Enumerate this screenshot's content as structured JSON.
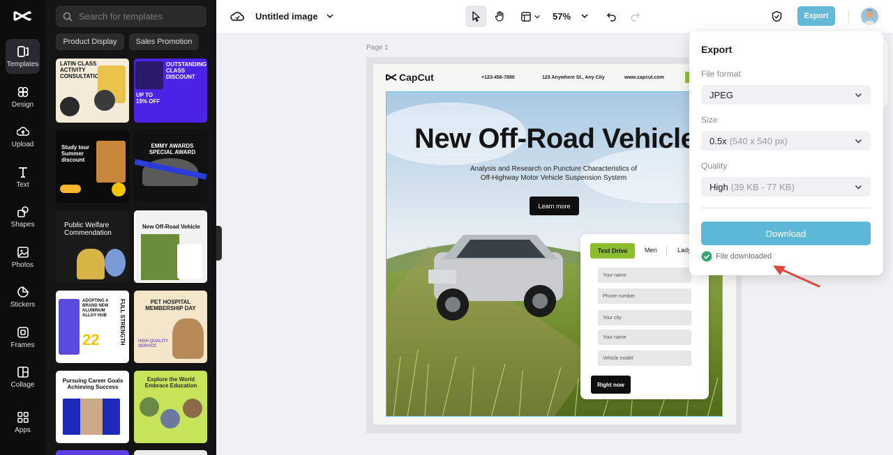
{
  "rail": {
    "items": [
      {
        "label": "Templates",
        "icon": "templates-icon"
      },
      {
        "label": "Design",
        "icon": "design-icon"
      },
      {
        "label": "Upload",
        "icon": "upload-icon"
      },
      {
        "label": "Text",
        "icon": "text-icon"
      },
      {
        "label": "Shapes",
        "icon": "shapes-icon"
      },
      {
        "label": "Photos",
        "icon": "photos-icon"
      },
      {
        "label": "Stickers",
        "icon": "stickers-icon"
      },
      {
        "label": "Frames",
        "icon": "frames-icon"
      },
      {
        "label": "Collage",
        "icon": "collage-icon"
      },
      {
        "label": "Apps",
        "icon": "apps-icon"
      }
    ],
    "active": "Templates"
  },
  "panel": {
    "search_placeholder": "Search for templates",
    "chips": [
      "Product Display",
      "Sales Promotion"
    ],
    "thumbs": [
      {
        "title": "LATIN CLASS ACTIVITY CONSULTATION"
      },
      {
        "title": "OUTSTANDING CLASS DISCOUNT",
        "extra": "UP TO 15% OFF"
      },
      {
        "title": "Study tour Summer discount"
      },
      {
        "title": "EMMY AWARDS SPECIAL AWARD"
      },
      {
        "title": "Public Welfare Commendation"
      },
      {
        "title": "New Off-Road Vehicle"
      },
      {
        "title": "ADOPTING A BRAND NEW ALUMINUM ALLOY HUB",
        "extra": "FULL STRENGTH",
        "num": "22"
      },
      {
        "title": "PET HOSPITAL MEMBERSHIP DAY",
        "extra": "HIGH QUALITY SERVICE"
      },
      {
        "title": "Pursuing Career Goals Achieving Success"
      },
      {
        "title": "Explore the World Embrace Education"
      }
    ]
  },
  "topbar": {
    "title": "Untitled image",
    "zoom": "57%",
    "export_label": "Export"
  },
  "canvas": {
    "page_label": "Page 1",
    "poster": {
      "brand": "CapCut",
      "phone": "+123-456-7890",
      "address": "123 Anywhere St., Any City",
      "website": "www.capcut.com",
      "headline": "New Off-Road Vehicle",
      "subline": "Analysis and Research on Puncture Characteristics of Off-Highway Motor Vehicle Suspension System",
      "cta": "Learn more",
      "form": {
        "tabs": [
          "Test Drive",
          "Men",
          "Lady"
        ],
        "fields": [
          "Your name",
          "Phone number",
          "Your city",
          "Your name",
          "Vehicle model"
        ],
        "submit": "Right now"
      }
    }
  },
  "export_panel": {
    "title": "Export",
    "file_format_label": "File format",
    "file_format_value": "JPEG",
    "size_label": "Size",
    "size_value": "0.5x",
    "size_detail": "(540 x 540 px)",
    "quality_label": "Quality",
    "quality_value": "High",
    "quality_detail": "(39 KB - 77 KB)",
    "download_label": "Download",
    "status": "File downloaded"
  },
  "colors": {
    "accent": "#5db8d8",
    "annotation_arrow": "#e0463a",
    "success": "#3aa676",
    "form_tab": "#8bbd2c"
  }
}
